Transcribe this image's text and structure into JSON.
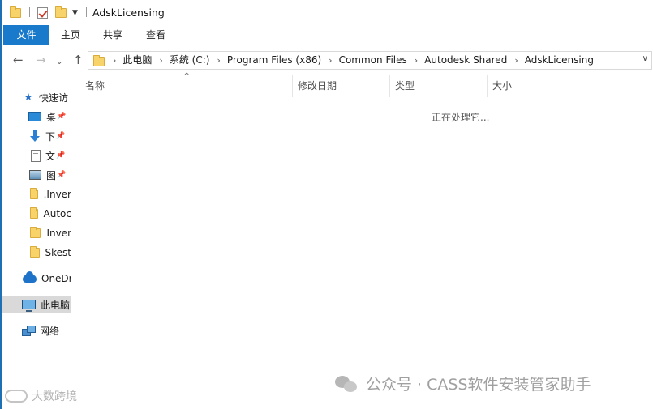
{
  "window": {
    "title": "AdskLicensing"
  },
  "ribbon": {
    "tabs": [
      "文件",
      "主页",
      "共享",
      "查看"
    ]
  },
  "address": {
    "crumbs": [
      "此电脑",
      "系统 (C:)",
      "Program Files (x86)",
      "Common Files",
      "Autodesk Shared",
      "AdskLicensing"
    ]
  },
  "navpane": {
    "quick_access": "快速访",
    "pinned": [
      "桌",
      "下",
      "文",
      "图"
    ],
    "folders": [
      ".Inver",
      "Autoc",
      "Inver",
      "Skest"
    ],
    "onedrive": "OneDr",
    "this_pc": "此电脑",
    "network": "网络"
  },
  "columns": {
    "name": "名称",
    "modified": "修改日期",
    "type": "类型",
    "size": "大小"
  },
  "status": "正在处理它...",
  "watermark": {
    "main": "公众号 · CASS软件安装管家助手",
    "corner": "大数跨境"
  },
  "colors": {
    "accent": "#1979ca",
    "folder": "#f7d36a",
    "selected_bg": "#d9d9d9"
  }
}
